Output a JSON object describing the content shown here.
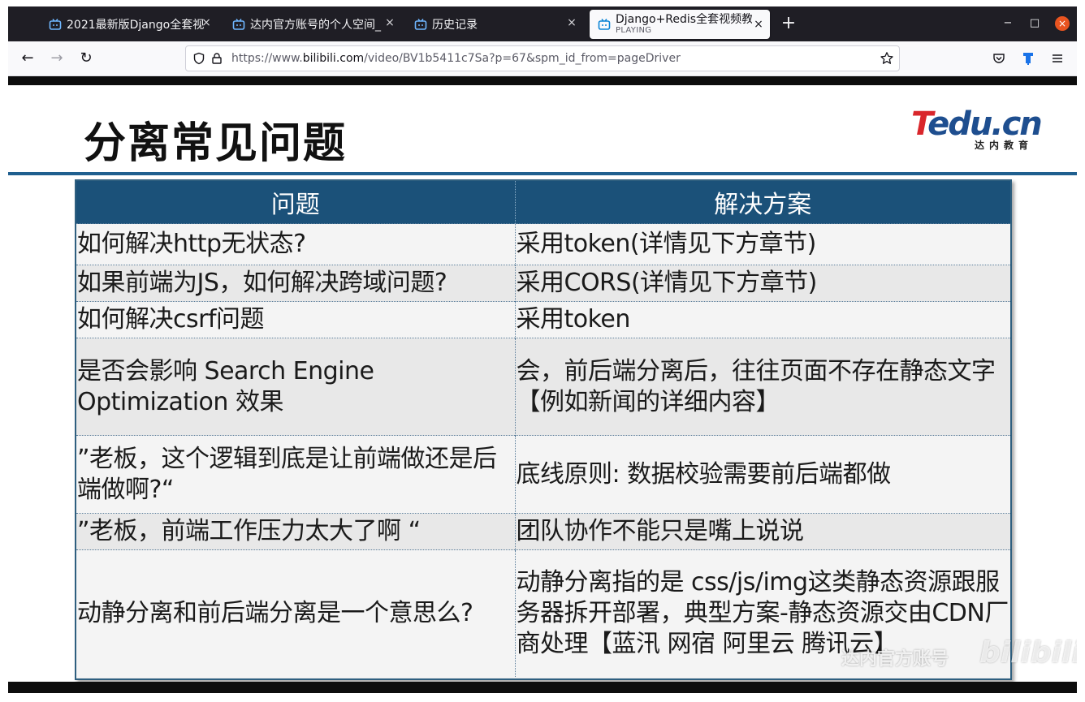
{
  "tabs": [
    {
      "label": "2021最新版Django全套视",
      "icon": "bilibili-tv-icon"
    },
    {
      "label": "达内官方账号的个人空间_",
      "icon": "bilibili-tv-icon"
    },
    {
      "label": "历史记录",
      "icon": "bilibili-tv-icon"
    },
    {
      "label": "Django+Redis全套视频教",
      "sub": "PLAYING",
      "icon": "bilibili-tv-icon",
      "active": true
    }
  ],
  "tab_close_glyph": "×",
  "new_tab_glyph": "+",
  "window": {
    "minimize": "−",
    "maximize": "□",
    "close": "×"
  },
  "nav": {
    "back": "←",
    "forward": "→",
    "reload": "↻"
  },
  "url": {
    "prefix": "https://www.",
    "host": "bilibili.com",
    "path": "/video/BV1b5411c7Sa?p=67&spm_id_from=pageDriver"
  },
  "slide": {
    "title": "分离常见问题",
    "logo": {
      "brand_t": "T",
      "brand_rest": "edu.cn",
      "sub": "达内教育"
    },
    "table": {
      "headers": [
        "问题",
        "解决方案"
      ],
      "rows": [
        {
          "q": "如何解决http无状态?",
          "a": "采用token(详情见下方章节)"
        },
        {
          "q": "如果前端为JS，如何解决跨域问题?",
          "a": "采用CORS(详情见下方章节)"
        },
        {
          "q": "如何解决csrf问题",
          "a": "采用token"
        },
        {
          "q": "是否会影响 Search Engine Optimization 效果",
          "a": "会，前后端分离后，往往页面不存在静态文字【例如新闻的详细内容】"
        },
        {
          "q": "”老板，这个逻辑到底是让前端做还是后端做啊?“",
          "a": "底线原则: 数据校验需要前后端都做"
        },
        {
          "q": "”老板，前端工作压力太大了啊 “",
          "a": "团队协作不能只是嘴上说说"
        },
        {
          "q": "动静分离和前后端分离是一个意思么?",
          "a": "动静分离指的是 css/js/img这类静态资源跟服务器拆开部署，典型方案-静态资源交由CDN厂商处理【蓝汛 网宿 阿里云 腾讯云】"
        }
      ]
    }
  },
  "watermark": {
    "text": "达内官方账号",
    "brand": "bilibili"
  }
}
